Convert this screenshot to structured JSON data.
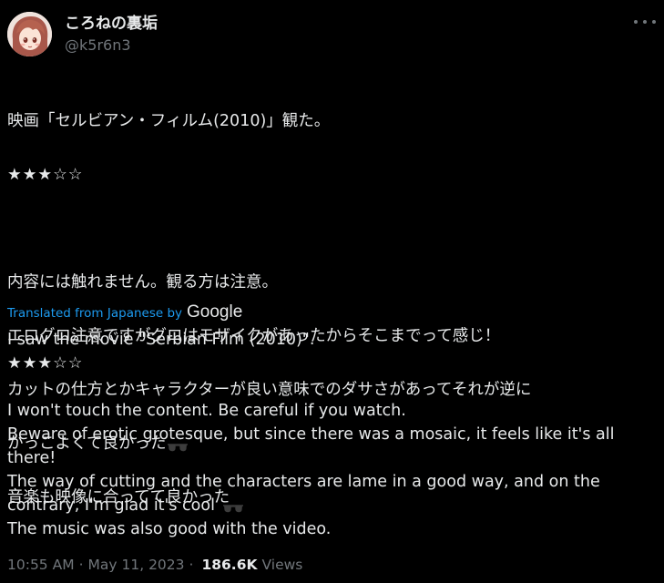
{
  "author": {
    "display_name": "ころねの裏垢",
    "handle": "@k5r6n3"
  },
  "tweet": {
    "lines": [
      "映画「セルビアン・フィルム(2010)」観た。",
      "★★★☆☆",
      "",
      "内容には触れません。観る方は注意。",
      "エログロ注意ですがグロはモザイクがあったからそこまでって感じ！",
      "カットの仕方とかキャラクターが良い意味でのダサさがあってそれが逆に",
      "かっこよくて良かった",
      "音楽も映像に合ってて良かった"
    ],
    "emoji": "sunglasses-emoji"
  },
  "translation": {
    "label": "Translated from Japanese by",
    "provider": "Google",
    "lines": [
      "I saw the movie \"Serbian Film (2010)\".",
      "★★★☆☆",
      "",
      "I won't touch the content. Be careful if you watch.",
      "Beware of erotic grotesque, but since there was a mosaic, it feels like it's all",
      "there!",
      "The way of cutting and the characters are lame in a good way, and on the",
      "contrary, I'm glad it's cool",
      "The music was also good with the video."
    ]
  },
  "meta": {
    "time": "10:55 AM",
    "separator": "·",
    "date": "May 11, 2023",
    "views_count": "186.6K",
    "views_label": "Views"
  },
  "colors": {
    "background": "#000000",
    "text": "#e7e9ea",
    "secondary": "#71767b",
    "link": "#1d9bf0"
  },
  "icons": {
    "more": "more-horizontal-icon",
    "avatar": "avatar-anime-girl"
  }
}
